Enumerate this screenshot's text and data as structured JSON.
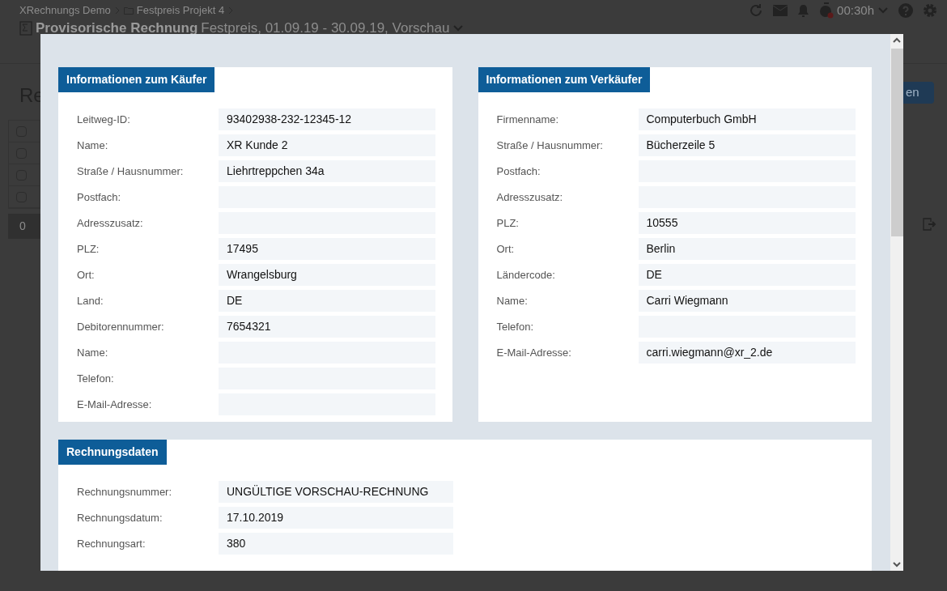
{
  "breadcrumb": [
    {
      "label": "XRechnungs Demo",
      "kind": "text"
    },
    {
      "label": "Festpreis Projekt 4",
      "kind": "folder"
    }
  ],
  "page_title": {
    "title": "Provisorische Rechnung",
    "subtitle": "Festpreis, 01.09.19 - 30.09.19, Vorschau"
  },
  "toolbar": {
    "timer": "00:30h"
  },
  "page_heading": "Re",
  "primary_button": "en",
  "table_rows": [
    {
      "checked": false
    },
    {
      "checked": false
    },
    {
      "checked": false
    },
    {
      "checked": false
    }
  ],
  "count_badge": "0",
  "modal": {
    "columns": [
      {
        "title": "Informationen zum Käufer",
        "fields": [
          {
            "label": "Leitweg-ID:",
            "value": "93402938-232-12345-12"
          },
          {
            "label": "Name:",
            "value": "XR Kunde 2"
          },
          {
            "label": "Straße / Hausnummer:",
            "value": "Liehrtreppchen 34a"
          },
          {
            "label": "Postfach:"
          },
          {
            "label": "Adresszusatz:"
          },
          {
            "label": "PLZ:",
            "value": "17495"
          },
          {
            "label": "Ort:",
            "value": "Wrangelsburg"
          },
          {
            "label": "Land:",
            "value": "DE"
          },
          {
            "label": "Debitorennummer:",
            "value": "7654321"
          },
          {
            "label": "Name:"
          },
          {
            "label": "Telefon:"
          },
          {
            "label": "E-Mail-Adresse:"
          }
        ]
      },
      {
        "title": "Informationen zum Verkäufer",
        "fields": [
          {
            "label": "Firmenname:",
            "value": "Computerbuch GmbH"
          },
          {
            "label": "Straße / Hausnummer:",
            "value": "Bücherzeile 5"
          },
          {
            "label": "Postfach:"
          },
          {
            "label": "Adresszusatz:"
          },
          {
            "label": "PLZ:",
            "value": "10555"
          },
          {
            "label": "Ort:",
            "value": "Berlin"
          },
          {
            "label": "Ländercode:",
            "value": "DE"
          },
          {
            "label": "Name:",
            "value": "Carri Wiegmann"
          },
          {
            "label": "Telefon:"
          },
          {
            "label": "E-Mail-Adresse:",
            "value": "carri.wiegmann@xr_2.de"
          }
        ]
      }
    ],
    "full_width": [
      {
        "title": "Rechnungsdaten",
        "fields": [
          {
            "label": "Rechnungsnummer:",
            "value": "UNGÜLTIGE VORSCHAU-RECHNUNG"
          },
          {
            "label": "Rechnungsdatum:",
            "value": "17.10.2019"
          },
          {
            "label": "Rechnungsart:",
            "value": "380"
          }
        ]
      }
    ]
  }
}
